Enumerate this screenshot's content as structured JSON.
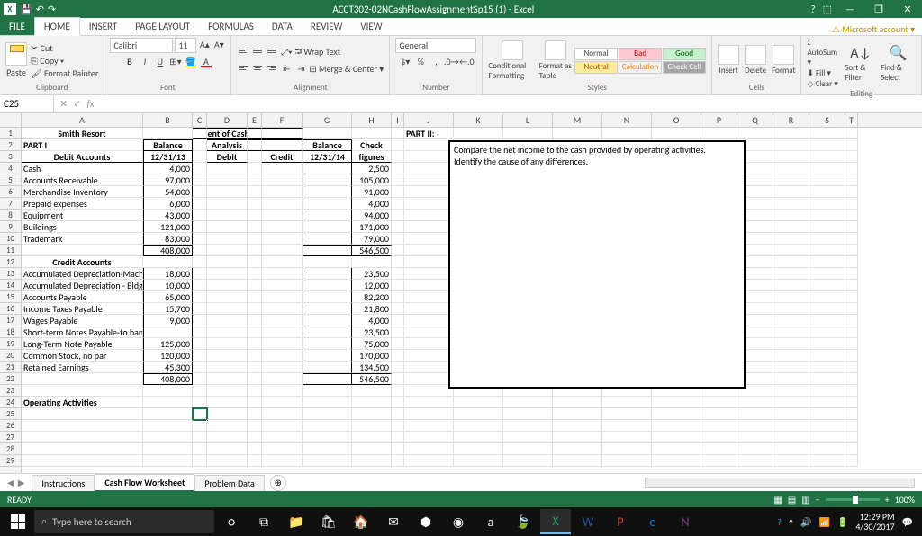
{
  "titlebar": {
    "app_title": "ACCT302-02NCashFlowAssignmentSp15 (1) - Excel",
    "ms_account": "Microsoft account"
  },
  "tabs": {
    "file": "FILE",
    "home": "HOME",
    "insert": "INSERT",
    "page_layout": "PAGE LAYOUT",
    "formulas": "FORMULAS",
    "data": "DATA",
    "review": "REVIEW",
    "view": "VIEW"
  },
  "ribbon": {
    "clipboard": {
      "paste": "Paste",
      "cut": "Cut",
      "copy": "Copy",
      "format_painter": "Format Painter",
      "label": "Clipboard"
    },
    "font": {
      "name": "Calibri",
      "size": "11",
      "label": "Font"
    },
    "alignment": {
      "wrap": "Wrap Text",
      "merge": "Merge & Center",
      "label": "Alignment"
    },
    "number": {
      "format": "General",
      "label": "Number"
    },
    "styles": {
      "conditional": "Conditional Formatting",
      "format_as": "Format as Table",
      "label": "Styles",
      "cells": {
        "normal": "Normal",
        "bad": "Bad",
        "good": "Good",
        "neutral": "Neutral",
        "calculation": "Calculation",
        "check_cell": "Check Cell"
      }
    },
    "cells": {
      "insert": "Insert",
      "delete": "Delete",
      "format": "Format",
      "label": "Cells"
    },
    "editing": {
      "autosum": "AutoSum",
      "fill": "Fill",
      "clear": "Clear",
      "sort": "Sort & Filter",
      "find": "Find & Select",
      "label": "Editing"
    }
  },
  "name_box": "C25",
  "columns": [
    "A",
    "B",
    "C",
    "D",
    "E",
    "F",
    "G",
    "H",
    "I",
    "J",
    "K",
    "L",
    "M",
    "N",
    "O",
    "P",
    "Q",
    "R",
    "S",
    "T"
  ],
  "col_widths": [
    "wA",
    "wB",
    "wC",
    "wD",
    "wE",
    "wF",
    "wG",
    "wH",
    "wI",
    "wJ",
    "wK",
    "wL",
    "wM",
    "wN",
    "wO",
    "wP",
    "wQ",
    "wR",
    "wS",
    "wT"
  ],
  "sheet": {
    "title_center": "Smith Resort",
    "stmt_title": "Statement of Cash Flows",
    "part1": "PART I",
    "part2": "PART II:",
    "balance": "Balance",
    "analysis": "Analysis",
    "check": "Check",
    "figures": "figures",
    "debit_accounts": "Debit Accounts",
    "date1": "12/31/13",
    "date2": "12/31/14",
    "debit": "Debit",
    "credit": "Credit",
    "credit_accounts": "Credit Accounts",
    "operating": "Operating Activities",
    "part2_text1": "Compare the net income to the cash provided by operating activities.",
    "part2_text2": "Identify the cause of any differences.",
    "debit_rows": [
      {
        "label": "Cash",
        "bal": "4,000",
        "chk": "2,500"
      },
      {
        "label": "Accounts Receivable",
        "bal": "97,000",
        "chk": "105,000"
      },
      {
        "label": "Merchandise Inventory",
        "bal": "54,000",
        "chk": "91,000"
      },
      {
        "label": "Prepaid expenses",
        "bal": "6,000",
        "chk": "4,000"
      },
      {
        "label": "Equipment",
        "bal": "43,000",
        "chk": "94,000"
      },
      {
        "label": "Buildings",
        "bal": "121,000",
        "chk": "171,000"
      },
      {
        "label": "Trademark",
        "bal": "83,000",
        "chk": "79,000"
      }
    ],
    "debit_total": {
      "bal": "408,000",
      "chk": "546,500"
    },
    "credit_rows": [
      {
        "label": "Accumulated Depreciation-Mach",
        "bal": "18,000",
        "chk": "23,500"
      },
      {
        "label": "Accumulated Depreciation - Bldg",
        "bal": "10,000",
        "chk": "12,000"
      },
      {
        "label": "Accounts Payable",
        "bal": "65,000",
        "chk": "82,200"
      },
      {
        "label": "Income Taxes Payable",
        "bal": "15,700",
        "chk": "21,800"
      },
      {
        "label": "Wages Payable",
        "bal": "9,000",
        "chk": "4,000"
      },
      {
        "label": "Short-term Notes Payable-to bank",
        "bal": "",
        "chk": "23,500"
      },
      {
        "label": "Long-Term Note Payable",
        "bal": "125,000",
        "chk": "75,000"
      },
      {
        "label": "Common Stock, no par",
        "bal": "120,000",
        "chk": "170,000"
      },
      {
        "label": "Retained Earnings",
        "bal": "45,300",
        "chk": "134,500"
      }
    ],
    "credit_total": {
      "bal": "408,000",
      "chk": "546,500"
    }
  },
  "sheet_tabs": {
    "t1": "Instructions",
    "t2": "Cash Flow Worksheet",
    "t3": "Problem Data"
  },
  "status": {
    "ready": "READY",
    "zoom": "100%"
  },
  "taskbar": {
    "search_placeholder": "Type here to search",
    "time": "12:29 PM",
    "date": "4/30/2017"
  }
}
